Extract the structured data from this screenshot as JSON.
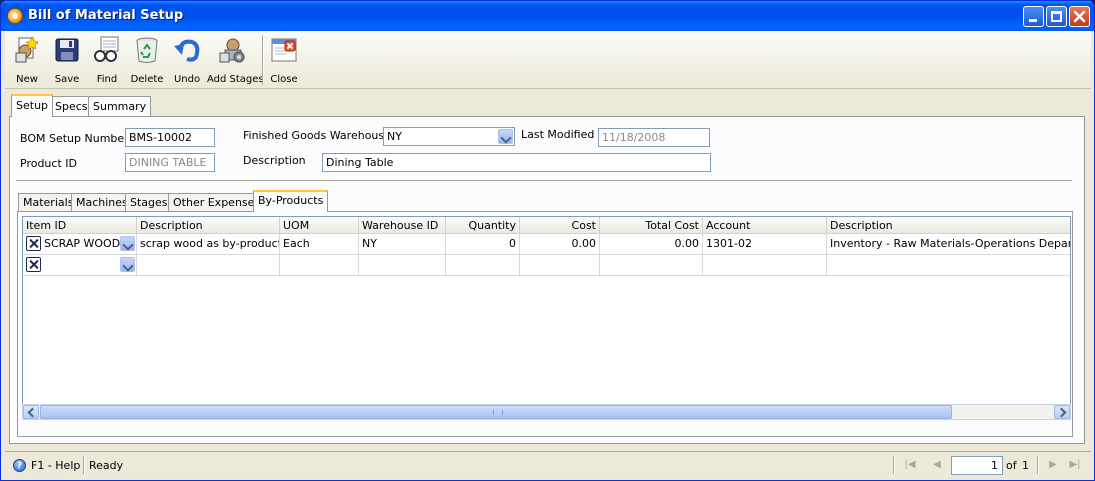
{
  "window": {
    "title": "Bill of Material Setup"
  },
  "toolbar": {
    "buttons": [
      {
        "label": "New",
        "icon": "new-icon"
      },
      {
        "label": "Save",
        "icon": "save-icon"
      },
      {
        "label": "Find",
        "icon": "find-icon"
      },
      {
        "label": "Delete",
        "icon": "delete-icon"
      },
      {
        "label": "Undo",
        "icon": "undo-icon"
      },
      {
        "label": "Add Stages",
        "icon": "add-stages-icon"
      },
      {
        "label": "Close",
        "icon": "close-icon"
      }
    ]
  },
  "main_tabs": [
    {
      "label": "Setup",
      "active": true
    },
    {
      "label": "Specs",
      "active": false
    },
    {
      "label": "Summary",
      "active": false
    }
  ],
  "form": {
    "bom_setup_number": {
      "label": "BOM Setup Number",
      "value": "BMS-10002"
    },
    "finished_goods_warehouse": {
      "label": "Finished Goods Warehouse",
      "value": "NY"
    },
    "last_modified": {
      "label": "Last Modified",
      "value": "11/18/2008"
    },
    "product_id": {
      "label": "Product ID",
      "value": "DINING TABLE"
    },
    "description": {
      "label": "Description",
      "value": "Dining Table"
    }
  },
  "detail_tabs": [
    {
      "label": "Materials",
      "active": false
    },
    {
      "label": "Machines",
      "active": false
    },
    {
      "label": "Stages",
      "active": false
    },
    {
      "label": "Other Expenses",
      "active": false
    },
    {
      "label": "By-Products",
      "active": true
    }
  ],
  "grid": {
    "columns": [
      "Item ID",
      "Description",
      "UOM",
      "Warehouse ID",
      "Quantity",
      "Cost",
      "Total Cost",
      "Account",
      "Description"
    ],
    "rows": [
      {
        "item_id": "SCRAP WOOD",
        "description": "scrap wood as by-product",
        "uom": "Each",
        "warehouse_id": "NY",
        "quantity": "0",
        "cost": "0.00",
        "total_cost": "0.00",
        "account": "1301-02",
        "account_description": "Inventory - Raw Materials-Operations Department"
      },
      {
        "item_id": "",
        "description": "",
        "uom": "",
        "warehouse_id": "",
        "quantity": "",
        "cost": "",
        "total_cost": "",
        "account": "",
        "account_description": ""
      }
    ]
  },
  "status": {
    "help": "F1 - Help",
    "text": "Ready",
    "page": "1",
    "of_label": "of",
    "total_pages": "1"
  },
  "colors": {
    "titlebar": "#0053ee",
    "active_tab_accent": "#ffc73c",
    "window_bg": "#ece9d8"
  }
}
